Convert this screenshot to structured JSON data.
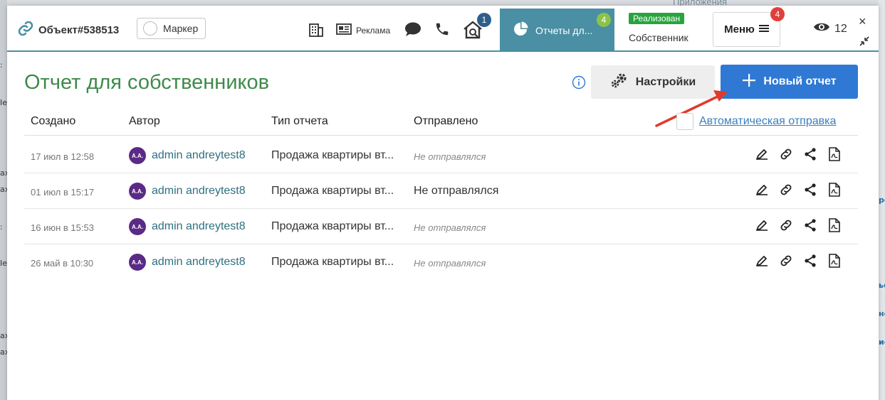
{
  "background": {
    "left_fragments": [
      ":",
      "Ie",
      "ax",
      "ax",
      ":",
      "Ie",
      "ax",
      "ax"
    ],
    "right_fragments": [
      "po",
      "ье",
      "не",
      "ие"
    ],
    "top_text": "Приложения"
  },
  "header": {
    "object_title": "Объект#538513",
    "marker_label": "Маркер",
    "adv_label": "Реклама",
    "notify_badge": "1",
    "active_tab_label": "Отчеты дл...",
    "active_tab_badge": "4",
    "status_pill": "Реализован",
    "owner_label": "Собственник",
    "menu_label": "Меню",
    "menu_badge": "4",
    "views_count": "12",
    "close_symbol": "×"
  },
  "content": {
    "title": "Отчет для собственников",
    "settings_label": "Настройки",
    "new_report_label": "Новый отчет",
    "columns": {
      "created": "Создано",
      "author": "Автор",
      "type": "Тип отчета",
      "sent": "Отправлено"
    },
    "auto_send_label": "Автоматическая отправка",
    "rows": [
      {
        "date": "17 июл в 12:58",
        "initials": "A.A.",
        "author": "admin andreytest8",
        "type": "Продажа квартиры вт...",
        "sent": "Не отправлялся",
        "sent_italic": true
      },
      {
        "date": "01 июл в 15:17",
        "initials": "A.A.",
        "author": "admin andreytest8",
        "type": "Продажа квартиры вт...",
        "sent": "Не отправлялся",
        "sent_italic": false
      },
      {
        "date": "16 июн в 15:53",
        "initials": "A.A.",
        "author": "admin andreytest8",
        "type": "Продажа квартиры вт...",
        "sent": "Не отправлялся",
        "sent_italic": true
      },
      {
        "date": "26 май в 10:30",
        "initials": "A.A.",
        "author": "admin andreytest8",
        "type": "Продажа квартиры вт...",
        "sent": "Не отправлялся",
        "sent_italic": true
      }
    ]
  },
  "colors": {
    "accent_teal": "#4a8fa3",
    "title_green": "#3f8a4a",
    "primary_blue": "#2f79d4",
    "badge_red": "#e0403a",
    "badge_green": "#8bc34a",
    "badge_navy": "#2e5f8a",
    "status_green": "#28a43f",
    "avatar_purple": "#5b2a86",
    "arrow_red": "#e03a2e"
  }
}
